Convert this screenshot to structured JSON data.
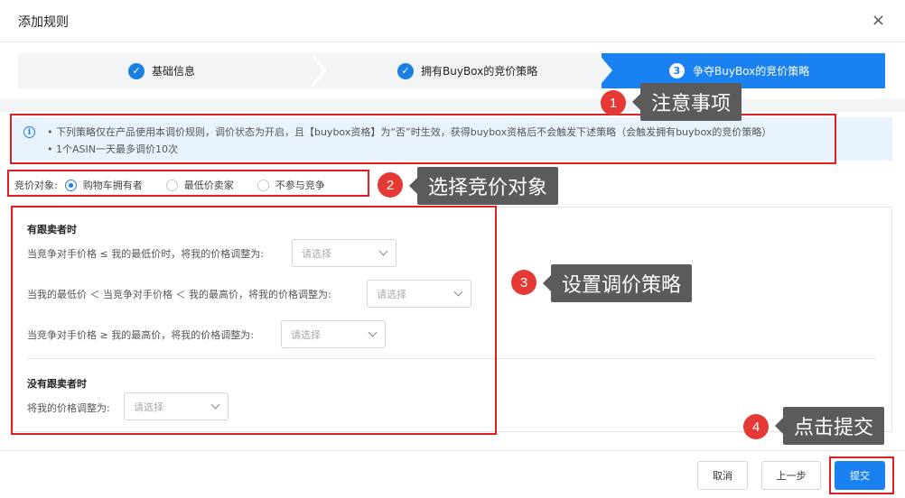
{
  "dialog": {
    "title": "添加规则",
    "close_glyph": "×"
  },
  "steps": [
    {
      "label": "基础信息",
      "state": "done"
    },
    {
      "label": "拥有BuyBox的竞价策略",
      "state": "done"
    },
    {
      "number": "3",
      "label": "争夺BuyBox的竞价策略",
      "state": "active"
    }
  ],
  "notice": {
    "line1": "• 下列策略仅在产品使用本调价规则，调价状态为开启，且【buybox资格】为“否”时生效，获得buybox资格后不会触发下述策略（会触发拥有buybox的竞价策略）",
    "line2": "• 1个ASIN一天最多调价10次"
  },
  "bid_target": {
    "label": "竞价对象:",
    "options": [
      "购物车拥有者",
      "最低价卖家",
      "不参与竞争"
    ],
    "selected": "购物车拥有者"
  },
  "with_followers": {
    "title": "有跟卖者时",
    "rules": [
      {
        "text": "当竞争对手价格 ≤ 我的最低价时，将我的价格调整为:",
        "placeholder": "请选择"
      },
      {
        "text": "当我的最低价 ＜ 当竞争对手价格 ＜ 我的最高价，将我的价格调整为:",
        "placeholder": "请选择"
      },
      {
        "text": "当竞争对手价格 ≥ 我的最高价，将我的价格调整为:",
        "placeholder": "请选择"
      }
    ]
  },
  "without_followers": {
    "title": "没有跟卖者时",
    "rule": {
      "text": "将我的价格调整为:",
      "placeholder": "请选择"
    }
  },
  "annotations": [
    {
      "number": "1",
      "text": "注意事项"
    },
    {
      "number": "2",
      "text": "选择竞价对象"
    },
    {
      "number": "3",
      "text": "设置调价策略"
    },
    {
      "number": "4",
      "text": "点击提交"
    }
  ],
  "footer": {
    "cancel": "取消",
    "prev": "上一步",
    "submit": "提交"
  },
  "colors": {
    "primary": "#1a82f0",
    "annotation_red": "#e02020",
    "tooltip_bg": "#5b5b5b",
    "notice_bg": "#e9f3fd"
  }
}
